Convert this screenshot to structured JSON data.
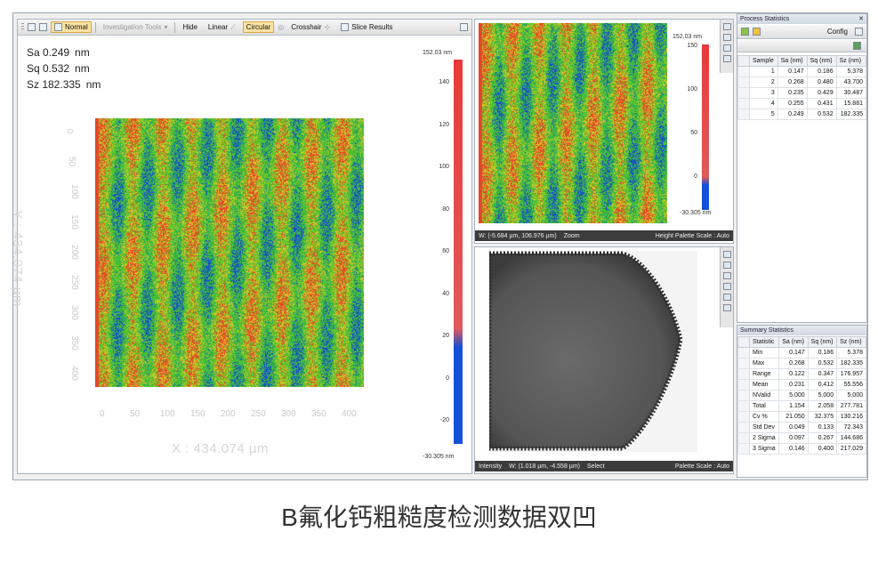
{
  "toolbar": {
    "normal": "Normal",
    "investigation_tools": "Investigation Tools",
    "hide": "Hide",
    "linear": "Linear",
    "circular": "Circular",
    "crosshair": "Crosshair",
    "slice_results": "Slice Results"
  },
  "roughness_overlay": {
    "sa": "Sa 0.249",
    "sq": "Sq 0.532",
    "sz": "Sz 182.335",
    "unit": "nm"
  },
  "main_plot": {
    "x_ticks": [
      "0",
      "50",
      "100",
      "150",
      "200",
      "250",
      "300",
      "350",
      "400"
    ],
    "y_ticks": [
      "0",
      "50",
      "100",
      "150",
      "200",
      "250",
      "300",
      "350",
      "400"
    ],
    "x_title": "X : 434.074 µm",
    "y_title": "Y : 434.074 µm",
    "colorbar_top": "152.03 nm",
    "colorbar_bottom": "-30.305 nm",
    "colorbar_ticks": [
      "140",
      "120",
      "100",
      "80",
      "60",
      "40",
      "20",
      "0",
      "-20"
    ]
  },
  "zoom_view": {
    "colorbar_top": "152.03 nm",
    "colorbar_bottom": "-30.305 nm",
    "colorbar_ticks": [
      "150",
      "100",
      "50",
      "0"
    ],
    "status_w": "W: (-5.684 µm, 106.976 µm)",
    "status_mode": "Zoom",
    "status_scale": "Height Palette Scale : Auto"
  },
  "intensity_view": {
    "status_type": "Intensity",
    "status_w": "W: (1.018 µm, -4.558 µm)",
    "status_mode": "Select",
    "status_scale": "Palette Scale : Auto"
  },
  "process_stats": {
    "title": "Process Statistics",
    "config": "Config",
    "headers": [
      "Sample",
      "Sa (nm)",
      "Sq (nm)",
      "Sz (nm)"
    ],
    "rows": [
      [
        "1",
        "0.147",
        "0.186",
        "5.378"
      ],
      [
        "2",
        "0.268",
        "0.480",
        "43.700"
      ],
      [
        "3",
        "0.235",
        "0.429",
        "30.487"
      ],
      [
        "4",
        "0.255",
        "0.431",
        "15.881"
      ],
      [
        "5",
        "0.249",
        "0.532",
        "182.335"
      ]
    ]
  },
  "summary_stats": {
    "title": "Summary Statistics",
    "headers": [
      "Statistic",
      "Sa (nm)",
      "Sq (nm)",
      "Sz (nm)"
    ],
    "rows": [
      [
        "Min",
        "0.147",
        "0.186",
        "5.378"
      ],
      [
        "Max",
        "0.268",
        "0.532",
        "182.335"
      ],
      [
        "Range",
        "0.122",
        "0.347",
        "176.957"
      ],
      [
        "Mean",
        "0.231",
        "0.412",
        "55.556"
      ],
      [
        "NValid",
        "5.000",
        "5.000",
        "5.000"
      ],
      [
        "Total",
        "1.154",
        "2.058",
        "277.781"
      ],
      [
        "Cv %",
        "21.050",
        "32.375",
        "130.216"
      ],
      [
        "Std Dev",
        "0.049",
        "0.133",
        "72.343"
      ],
      [
        "2 Sigma",
        "0.097",
        "0.267",
        "144.686"
      ],
      [
        "3 Sigma",
        "0.146",
        "0.400",
        "217.029"
      ]
    ]
  },
  "caption": "B氟化钙粗糙度检测数据双凹"
}
